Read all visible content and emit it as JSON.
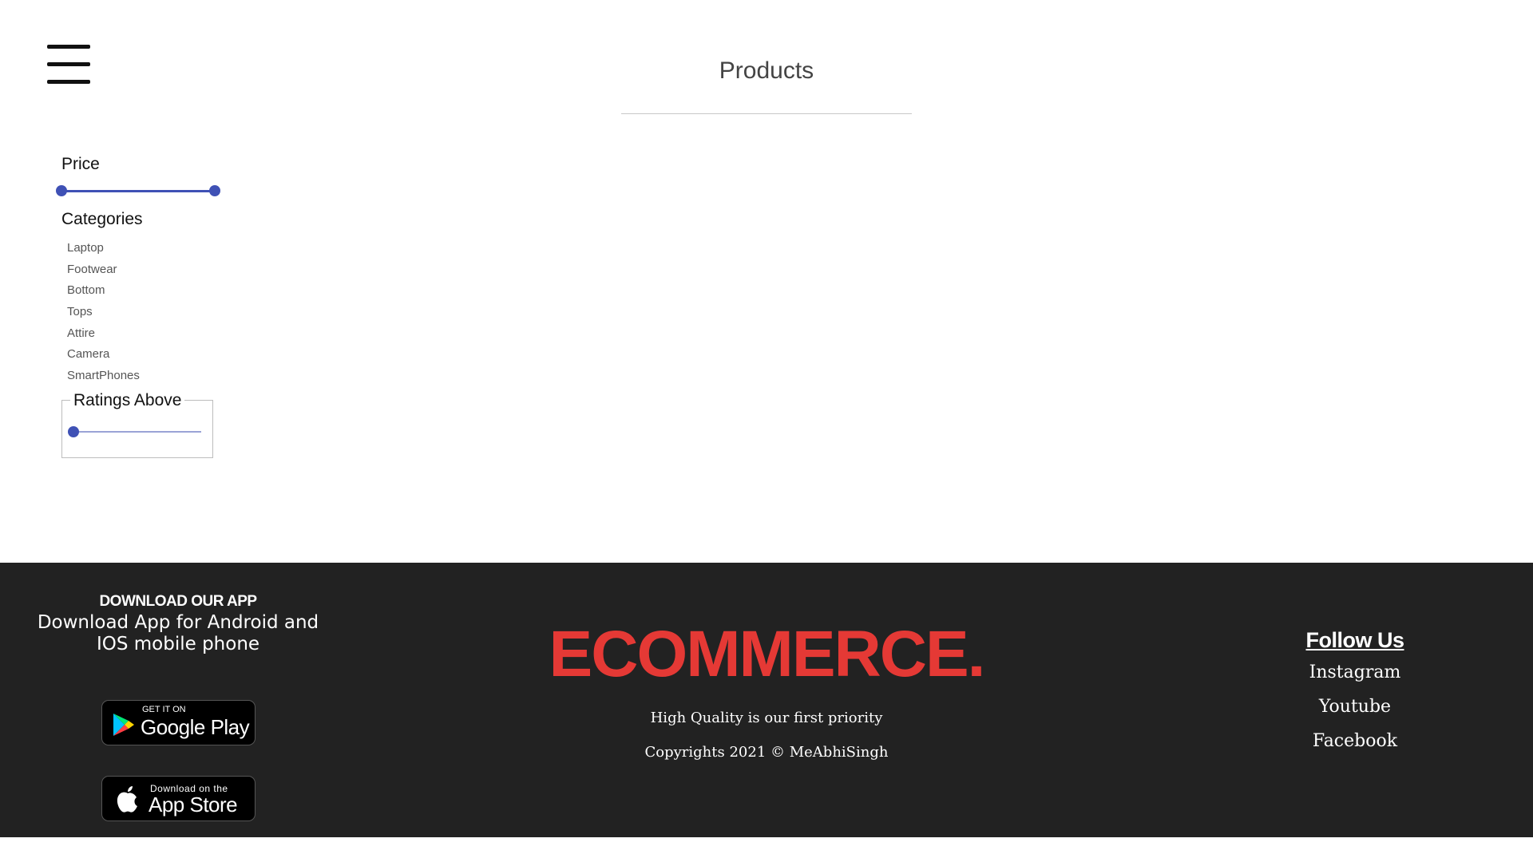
{
  "header": {
    "menu_icon": "hamburger-menu-icon",
    "title": "Products"
  },
  "filters": {
    "price": {
      "label": "Price",
      "range_min_fraction": 0,
      "range_max_fraction": 1,
      "color": "#3f51b5"
    },
    "categories": {
      "label": "Categories",
      "items": [
        "Laptop",
        "Footwear",
        "Bottom",
        "Tops",
        "Attire",
        "Camera",
        "SmartPhones"
      ]
    },
    "ratings": {
      "label": "Ratings Above",
      "value_fraction": 0
    }
  },
  "footer": {
    "background": "#222222",
    "download": {
      "title": "DOWNLOAD OUR APP",
      "text": "Download App for Android and IOS mobile phone",
      "google_play": {
        "small": "GET IT ON",
        "big": "Google Play",
        "icon": "google-play-icon"
      },
      "app_store": {
        "small": "Download on the",
        "big": "App Store",
        "icon": "apple-icon"
      }
    },
    "brand": {
      "name": "ECOMMERCE.",
      "color": "#e53935",
      "tagline": "High Quality is our first priority",
      "copyright": "Copyrights 2021 © MeAbhiSingh"
    },
    "social": {
      "title": "Follow Us",
      "links": [
        "Instagram",
        "Youtube",
        "Facebook"
      ]
    }
  }
}
